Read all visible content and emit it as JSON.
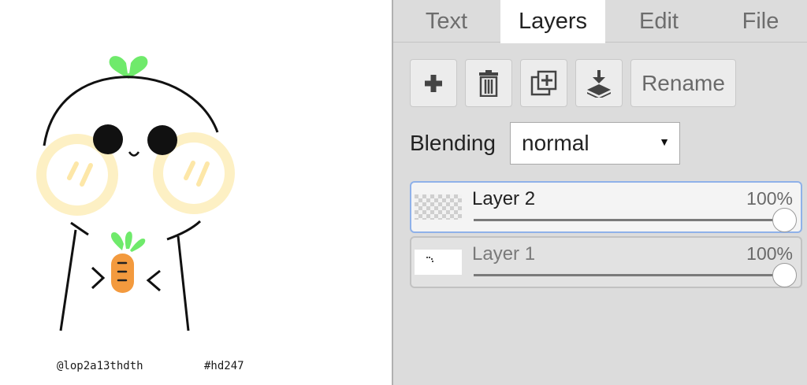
{
  "canvas": {
    "credit_handle": "@lop2a13thdth",
    "credit_tag": "#hd247"
  },
  "panel": {
    "tabs": [
      {
        "label": "Text",
        "active": false
      },
      {
        "label": "Layers",
        "active": true
      },
      {
        "label": "Edit",
        "active": false
      },
      {
        "label": "File",
        "active": false
      }
    ],
    "toolbar": {
      "add_icon": "plus-icon",
      "delete_icon": "trash-icon",
      "duplicate_icon": "duplicate-layer-icon",
      "merge_icon": "merge-down-icon",
      "rename_label": "Rename"
    },
    "blending": {
      "label": "Blending",
      "value": "normal"
    },
    "layers": [
      {
        "name": "Layer 2",
        "opacity_text": "100%",
        "opacity": 1.0,
        "selected": true,
        "thumb": "transparent-checker"
      },
      {
        "name": "Layer 1",
        "opacity_text": "100%",
        "opacity": 1.0,
        "selected": false,
        "thumb": "mini-drawing"
      }
    ]
  },
  "colors": {
    "panel_bg": "#dcdcdc",
    "active_tab": "#ffffff",
    "selected_layer_border": "#8fb1e9",
    "leaf_green": "#6fea6b",
    "carrot_orange": "#f39a3e",
    "cheek_yellow": "#fdf0c4"
  }
}
